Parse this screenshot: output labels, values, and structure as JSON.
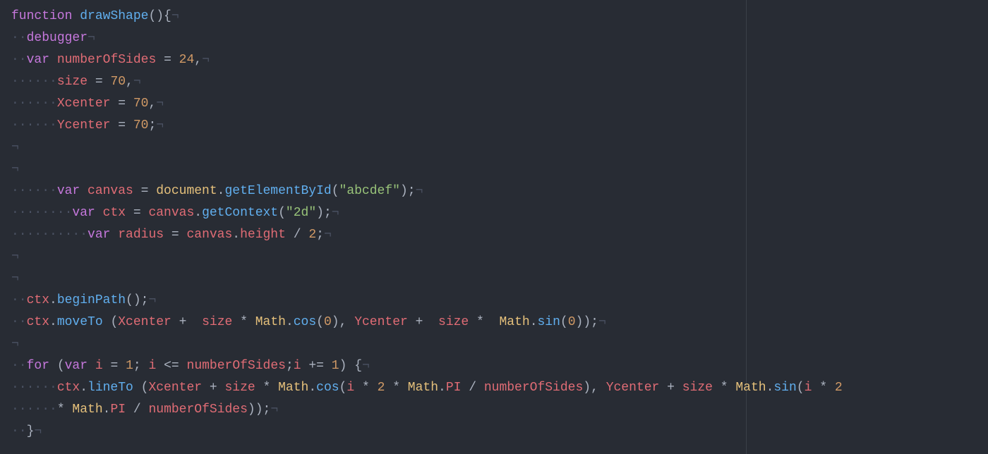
{
  "editor": {
    "ruler_column": 80,
    "ws_dot": "·",
    "ret_glyph": "¬",
    "lines": [
      {
        "segments": [
          {
            "t": "kw",
            "v": "function"
          },
          {
            "t": "punct",
            "v": " "
          },
          {
            "t": "fn",
            "v": "drawShape"
          },
          {
            "t": "punct",
            "v": "(){"
          },
          {
            "t": "ret",
            "v": "¬"
          }
        ]
      },
      {
        "segments": [
          {
            "t": "ws",
            "v": "··"
          },
          {
            "t": "kw",
            "v": "debugger"
          },
          {
            "t": "ret",
            "v": "¬"
          }
        ]
      },
      {
        "segments": [
          {
            "t": "ws",
            "v": "··"
          },
          {
            "t": "kw",
            "v": "var"
          },
          {
            "t": "punct",
            "v": " "
          },
          {
            "t": "var",
            "v": "numberOfSides"
          },
          {
            "t": "punct",
            "v": " = "
          },
          {
            "t": "num",
            "v": "24"
          },
          {
            "t": "punct",
            "v": ","
          },
          {
            "t": "ret",
            "v": "¬"
          }
        ]
      },
      {
        "segments": [
          {
            "t": "ws",
            "v": "······"
          },
          {
            "t": "var",
            "v": "size"
          },
          {
            "t": "punct",
            "v": " = "
          },
          {
            "t": "num",
            "v": "70"
          },
          {
            "t": "punct",
            "v": ","
          },
          {
            "t": "ret",
            "v": "¬"
          }
        ]
      },
      {
        "segments": [
          {
            "t": "ws",
            "v": "······"
          },
          {
            "t": "var",
            "v": "Xcenter"
          },
          {
            "t": "punct",
            "v": " = "
          },
          {
            "t": "num",
            "v": "70"
          },
          {
            "t": "punct",
            "v": ","
          },
          {
            "t": "ret",
            "v": "¬"
          }
        ]
      },
      {
        "segments": [
          {
            "t": "ws",
            "v": "······"
          },
          {
            "t": "var",
            "v": "Ycenter"
          },
          {
            "t": "punct",
            "v": " = "
          },
          {
            "t": "num",
            "v": "70"
          },
          {
            "t": "punct",
            "v": ";"
          },
          {
            "t": "ret",
            "v": "¬"
          }
        ]
      },
      {
        "segments": [
          {
            "t": "ret",
            "v": "¬"
          }
        ]
      },
      {
        "segments": [
          {
            "t": "ret",
            "v": "¬"
          }
        ]
      },
      {
        "segments": [
          {
            "t": "ws",
            "v": "······"
          },
          {
            "t": "kw",
            "v": "var"
          },
          {
            "t": "punct",
            "v": " "
          },
          {
            "t": "var",
            "v": "canvas"
          },
          {
            "t": "punct",
            "v": " = "
          },
          {
            "t": "obj",
            "v": "document"
          },
          {
            "t": "punct",
            "v": "."
          },
          {
            "t": "fn",
            "v": "getElementById"
          },
          {
            "t": "punct",
            "v": "("
          },
          {
            "t": "str",
            "v": "\"abcdef\""
          },
          {
            "t": "punct",
            "v": ");"
          },
          {
            "t": "ret",
            "v": "¬"
          }
        ]
      },
      {
        "segments": [
          {
            "t": "ws",
            "v": "········"
          },
          {
            "t": "kw",
            "v": "var"
          },
          {
            "t": "punct",
            "v": " "
          },
          {
            "t": "var",
            "v": "ctx"
          },
          {
            "t": "punct",
            "v": " = "
          },
          {
            "t": "var",
            "v": "canvas"
          },
          {
            "t": "punct",
            "v": "."
          },
          {
            "t": "fn",
            "v": "getContext"
          },
          {
            "t": "punct",
            "v": "("
          },
          {
            "t": "str",
            "v": "\"2d\""
          },
          {
            "t": "punct",
            "v": ");"
          },
          {
            "t": "ret",
            "v": "¬"
          }
        ]
      },
      {
        "segments": [
          {
            "t": "ws",
            "v": "··········"
          },
          {
            "t": "kw",
            "v": "var"
          },
          {
            "t": "punct",
            "v": " "
          },
          {
            "t": "var",
            "v": "radius"
          },
          {
            "t": "punct",
            "v": " = "
          },
          {
            "t": "var",
            "v": "canvas"
          },
          {
            "t": "punct",
            "v": "."
          },
          {
            "t": "var",
            "v": "height"
          },
          {
            "t": "punct",
            "v": " / "
          },
          {
            "t": "num",
            "v": "2"
          },
          {
            "t": "punct",
            "v": ";"
          },
          {
            "t": "ret",
            "v": "¬"
          }
        ]
      },
      {
        "segments": [
          {
            "t": "ret",
            "v": "¬"
          }
        ]
      },
      {
        "segments": [
          {
            "t": "ret",
            "v": "¬"
          }
        ]
      },
      {
        "segments": [
          {
            "t": "ws",
            "v": "··"
          },
          {
            "t": "var",
            "v": "ctx"
          },
          {
            "t": "punct",
            "v": "."
          },
          {
            "t": "fn",
            "v": "beginPath"
          },
          {
            "t": "punct",
            "v": "();"
          },
          {
            "t": "ret",
            "v": "¬"
          }
        ]
      },
      {
        "segments": [
          {
            "t": "ws",
            "v": "··"
          },
          {
            "t": "var",
            "v": "ctx"
          },
          {
            "t": "punct",
            "v": "."
          },
          {
            "t": "fn",
            "v": "moveTo"
          },
          {
            "t": "punct",
            "v": " ("
          },
          {
            "t": "var",
            "v": "Xcenter"
          },
          {
            "t": "punct",
            "v": " +  "
          },
          {
            "t": "var",
            "v": "size"
          },
          {
            "t": "punct",
            "v": " * "
          },
          {
            "t": "obj",
            "v": "Math"
          },
          {
            "t": "punct",
            "v": "."
          },
          {
            "t": "fn",
            "v": "cos"
          },
          {
            "t": "punct",
            "v": "("
          },
          {
            "t": "num",
            "v": "0"
          },
          {
            "t": "punct",
            "v": "), "
          },
          {
            "t": "var",
            "v": "Ycenter"
          },
          {
            "t": "punct",
            "v": " +  "
          },
          {
            "t": "var",
            "v": "size"
          },
          {
            "t": "punct",
            "v": " *  "
          },
          {
            "t": "obj",
            "v": "Math"
          },
          {
            "t": "punct",
            "v": "."
          },
          {
            "t": "fn",
            "v": "sin"
          },
          {
            "t": "punct",
            "v": "("
          },
          {
            "t": "num",
            "v": "0"
          },
          {
            "t": "punct",
            "v": "));"
          },
          {
            "t": "ret",
            "v": "¬"
          }
        ]
      },
      {
        "segments": [
          {
            "t": "ret",
            "v": "¬"
          }
        ]
      },
      {
        "segments": [
          {
            "t": "ws",
            "v": "··"
          },
          {
            "t": "kw",
            "v": "for"
          },
          {
            "t": "punct",
            "v": " ("
          },
          {
            "t": "kw",
            "v": "var"
          },
          {
            "t": "punct",
            "v": " "
          },
          {
            "t": "var",
            "v": "i"
          },
          {
            "t": "punct",
            "v": " = "
          },
          {
            "t": "num",
            "v": "1"
          },
          {
            "t": "punct",
            "v": "; "
          },
          {
            "t": "var",
            "v": "i"
          },
          {
            "t": "punct",
            "v": " <= "
          },
          {
            "t": "var",
            "v": "numberOfSides"
          },
          {
            "t": "punct",
            "v": ";"
          },
          {
            "t": "var",
            "v": "i"
          },
          {
            "t": "punct",
            "v": " += "
          },
          {
            "t": "num",
            "v": "1"
          },
          {
            "t": "punct",
            "v": ") {"
          },
          {
            "t": "ret",
            "v": "¬"
          }
        ]
      },
      {
        "segments": [
          {
            "t": "ws",
            "v": "······"
          },
          {
            "t": "var",
            "v": "ctx"
          },
          {
            "t": "punct",
            "v": "."
          },
          {
            "t": "fn",
            "v": "lineTo"
          },
          {
            "t": "punct",
            "v": " ("
          },
          {
            "t": "var",
            "v": "Xcenter"
          },
          {
            "t": "punct",
            "v": " + "
          },
          {
            "t": "var",
            "v": "size"
          },
          {
            "t": "punct",
            "v": " * "
          },
          {
            "t": "obj",
            "v": "Math"
          },
          {
            "t": "punct",
            "v": "."
          },
          {
            "t": "fn",
            "v": "cos"
          },
          {
            "t": "punct",
            "v": "("
          },
          {
            "t": "var",
            "v": "i"
          },
          {
            "t": "punct",
            "v": " * "
          },
          {
            "t": "num",
            "v": "2"
          },
          {
            "t": "punct",
            "v": " * "
          },
          {
            "t": "obj",
            "v": "Math"
          },
          {
            "t": "punct",
            "v": "."
          },
          {
            "t": "var",
            "v": "PI"
          },
          {
            "t": "punct",
            "v": " / "
          },
          {
            "t": "var",
            "v": "numberOfSides"
          },
          {
            "t": "punct",
            "v": "), "
          },
          {
            "t": "var",
            "v": "Ycenter"
          },
          {
            "t": "punct",
            "v": " + "
          },
          {
            "t": "var",
            "v": "size"
          },
          {
            "t": "punct",
            "v": " * "
          },
          {
            "t": "obj",
            "v": "Math"
          },
          {
            "t": "punct",
            "v": "."
          },
          {
            "t": "fn",
            "v": "sin"
          },
          {
            "t": "punct",
            "v": "("
          },
          {
            "t": "var",
            "v": "i"
          },
          {
            "t": "punct",
            "v": " * "
          },
          {
            "t": "num",
            "v": "2"
          }
        ]
      },
      {
        "segments": [
          {
            "t": "ws",
            "v": "······"
          },
          {
            "t": "punct",
            "v": "* "
          },
          {
            "t": "obj",
            "v": "Math"
          },
          {
            "t": "punct",
            "v": "."
          },
          {
            "t": "var",
            "v": "PI"
          },
          {
            "t": "punct",
            "v": " / "
          },
          {
            "t": "var",
            "v": "numberOfSides"
          },
          {
            "t": "punct",
            "v": "));"
          },
          {
            "t": "ret",
            "v": "¬"
          }
        ]
      },
      {
        "segments": [
          {
            "t": "ws",
            "v": "··"
          },
          {
            "t": "punct",
            "v": "}"
          },
          {
            "t": "ret",
            "v": "¬"
          }
        ]
      }
    ]
  }
}
